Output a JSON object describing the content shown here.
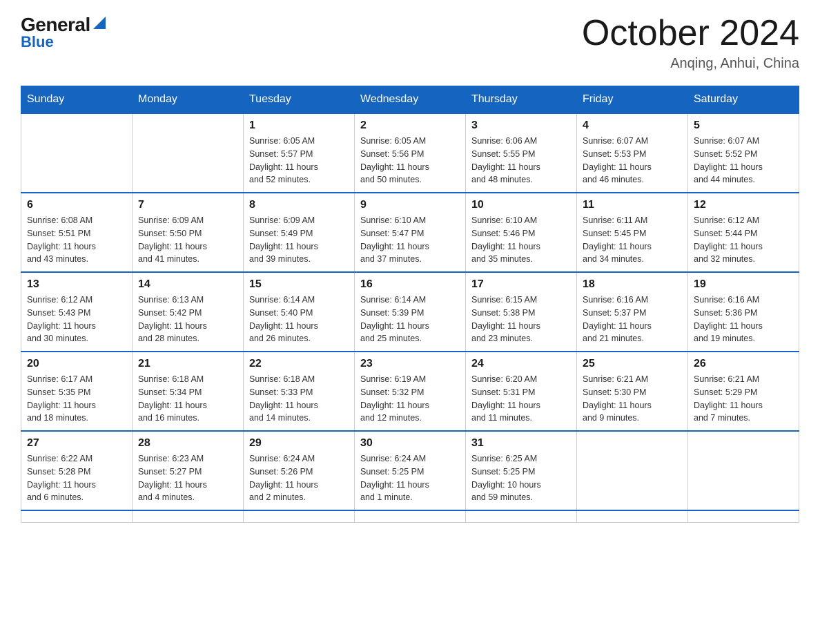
{
  "header": {
    "logo_general": "General",
    "logo_blue": "Blue",
    "month_title": "October 2024",
    "location": "Anqing, Anhui, China"
  },
  "weekdays": [
    "Sunday",
    "Monday",
    "Tuesday",
    "Wednesday",
    "Thursday",
    "Friday",
    "Saturday"
  ],
  "days": [
    {
      "date": "",
      "info": ""
    },
    {
      "date": "",
      "info": ""
    },
    {
      "date": "1",
      "sunrise": "6:05 AM",
      "sunset": "5:57 PM",
      "daylight": "11 hours and 52 minutes."
    },
    {
      "date": "2",
      "sunrise": "6:05 AM",
      "sunset": "5:56 PM",
      "daylight": "11 hours and 50 minutes."
    },
    {
      "date": "3",
      "sunrise": "6:06 AM",
      "sunset": "5:55 PM",
      "daylight": "11 hours and 48 minutes."
    },
    {
      "date": "4",
      "sunrise": "6:07 AM",
      "sunset": "5:53 PM",
      "daylight": "11 hours and 46 minutes."
    },
    {
      "date": "5",
      "sunrise": "6:07 AM",
      "sunset": "5:52 PM",
      "daylight": "11 hours and 44 minutes."
    },
    {
      "date": "6",
      "sunrise": "6:08 AM",
      "sunset": "5:51 PM",
      "daylight": "11 hours and 43 minutes."
    },
    {
      "date": "7",
      "sunrise": "6:09 AM",
      "sunset": "5:50 PM",
      "daylight": "11 hours and 41 minutes."
    },
    {
      "date": "8",
      "sunrise": "6:09 AM",
      "sunset": "5:49 PM",
      "daylight": "11 hours and 39 minutes."
    },
    {
      "date": "9",
      "sunrise": "6:10 AM",
      "sunset": "5:47 PM",
      "daylight": "11 hours and 37 minutes."
    },
    {
      "date": "10",
      "sunrise": "6:10 AM",
      "sunset": "5:46 PM",
      "daylight": "11 hours and 35 minutes."
    },
    {
      "date": "11",
      "sunrise": "6:11 AM",
      "sunset": "5:45 PM",
      "daylight": "11 hours and 34 minutes."
    },
    {
      "date": "12",
      "sunrise": "6:12 AM",
      "sunset": "5:44 PM",
      "daylight": "11 hours and 32 minutes."
    },
    {
      "date": "13",
      "sunrise": "6:12 AM",
      "sunset": "5:43 PM",
      "daylight": "11 hours and 30 minutes."
    },
    {
      "date": "14",
      "sunrise": "6:13 AM",
      "sunset": "5:42 PM",
      "daylight": "11 hours and 28 minutes."
    },
    {
      "date": "15",
      "sunrise": "6:14 AM",
      "sunset": "5:40 PM",
      "daylight": "11 hours and 26 minutes."
    },
    {
      "date": "16",
      "sunrise": "6:14 AM",
      "sunset": "5:39 PM",
      "daylight": "11 hours and 25 minutes."
    },
    {
      "date": "17",
      "sunrise": "6:15 AM",
      "sunset": "5:38 PM",
      "daylight": "11 hours and 23 minutes."
    },
    {
      "date": "18",
      "sunrise": "6:16 AM",
      "sunset": "5:37 PM",
      "daylight": "11 hours and 21 minutes."
    },
    {
      "date": "19",
      "sunrise": "6:16 AM",
      "sunset": "5:36 PM",
      "daylight": "11 hours and 19 minutes."
    },
    {
      "date": "20",
      "sunrise": "6:17 AM",
      "sunset": "5:35 PM",
      "daylight": "11 hours and 18 minutes."
    },
    {
      "date": "21",
      "sunrise": "6:18 AM",
      "sunset": "5:34 PM",
      "daylight": "11 hours and 16 minutes."
    },
    {
      "date": "22",
      "sunrise": "6:18 AM",
      "sunset": "5:33 PM",
      "daylight": "11 hours and 14 minutes."
    },
    {
      "date": "23",
      "sunrise": "6:19 AM",
      "sunset": "5:32 PM",
      "daylight": "11 hours and 12 minutes."
    },
    {
      "date": "24",
      "sunrise": "6:20 AM",
      "sunset": "5:31 PM",
      "daylight": "11 hours and 11 minutes."
    },
    {
      "date": "25",
      "sunrise": "6:21 AM",
      "sunset": "5:30 PM",
      "daylight": "11 hours and 9 minutes."
    },
    {
      "date": "26",
      "sunrise": "6:21 AM",
      "sunset": "5:29 PM",
      "daylight": "11 hours and 7 minutes."
    },
    {
      "date": "27",
      "sunrise": "6:22 AM",
      "sunset": "5:28 PM",
      "daylight": "11 hours and 6 minutes."
    },
    {
      "date": "28",
      "sunrise": "6:23 AM",
      "sunset": "5:27 PM",
      "daylight": "11 hours and 4 minutes."
    },
    {
      "date": "29",
      "sunrise": "6:24 AM",
      "sunset": "5:26 PM",
      "daylight": "11 hours and 2 minutes."
    },
    {
      "date": "30",
      "sunrise": "6:24 AM",
      "sunset": "5:25 PM",
      "daylight": "11 hours and 1 minute."
    },
    {
      "date": "31",
      "sunrise": "6:25 AM",
      "sunset": "5:25 PM",
      "daylight": "10 hours and 59 minutes."
    },
    {
      "date": "",
      "info": ""
    },
    {
      "date": "",
      "info": ""
    },
    {
      "date": "",
      "info": ""
    },
    {
      "date": "",
      "info": ""
    }
  ],
  "labels": {
    "sunrise": "Sunrise:",
    "sunset": "Sunset:",
    "daylight": "Daylight:"
  }
}
